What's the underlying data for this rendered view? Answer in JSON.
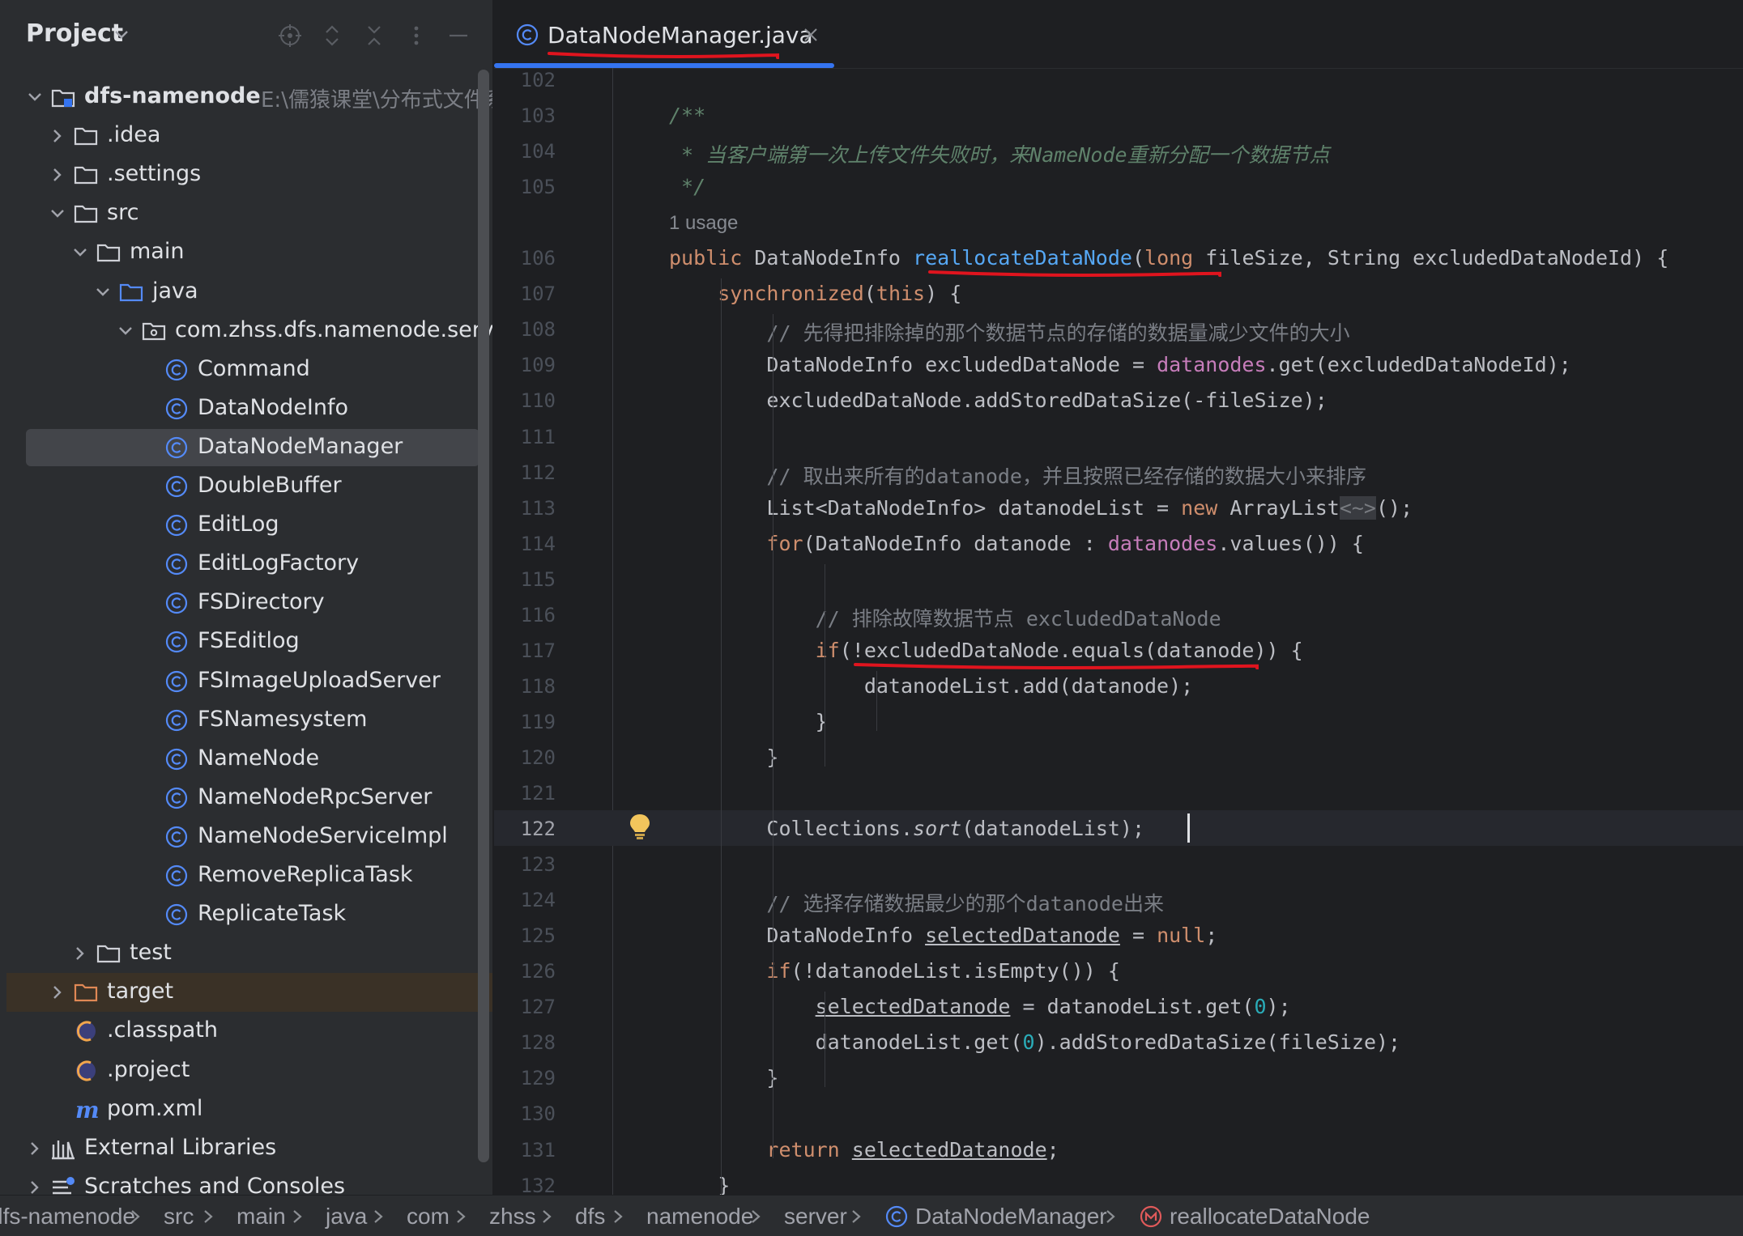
{
  "project_panel": {
    "title": "Project",
    "tree": [
      {
        "label": "dfs-namenode",
        "path": "E:\\儒猿课堂\\分布式文件系",
        "type": "module",
        "expanded": true
      },
      {
        "label": ".idea",
        "type": "folder",
        "expanded": false
      },
      {
        "label": ".settings",
        "type": "folder",
        "expanded": false
      },
      {
        "label": "src",
        "type": "folder",
        "expanded": true
      },
      {
        "label": "main",
        "type": "folder",
        "expanded": true
      },
      {
        "label": "java",
        "type": "source-folder",
        "expanded": true
      },
      {
        "label": "com.zhss.dfs.namenode.server",
        "type": "package",
        "expanded": true
      },
      {
        "label": "Command",
        "type": "class"
      },
      {
        "label": "DataNodeInfo",
        "type": "class"
      },
      {
        "label": "DataNodeManager",
        "type": "class",
        "selected": true
      },
      {
        "label": "DoubleBuffer",
        "type": "class"
      },
      {
        "label": "EditLog",
        "type": "class"
      },
      {
        "label": "EditLogFactory",
        "type": "class"
      },
      {
        "label": "FSDirectory",
        "type": "class"
      },
      {
        "label": "FSEditlog",
        "type": "class"
      },
      {
        "label": "FSImageUploadServer",
        "type": "class"
      },
      {
        "label": "FSNamesystem",
        "type": "class"
      },
      {
        "label": "NameNode",
        "type": "class"
      },
      {
        "label": "NameNodeRpcServer",
        "type": "class"
      },
      {
        "label": "NameNodeServiceImpl",
        "type": "class"
      },
      {
        "label": "RemoveReplicaTask",
        "type": "class"
      },
      {
        "label": "ReplicateTask",
        "type": "class"
      },
      {
        "label": "test",
        "type": "folder",
        "expanded": false
      },
      {
        "label": "target",
        "type": "excluded-folder",
        "expanded": false
      },
      {
        "label": ".classpath",
        "type": "eclipse-file"
      },
      {
        "label": ".project",
        "type": "eclipse-file"
      },
      {
        "label": "pom.xml",
        "type": "maven-file"
      },
      {
        "label": "External Libraries",
        "type": "libraries",
        "expanded": false
      },
      {
        "label": "Scratches and Consoles",
        "type": "scratches",
        "expanded": false
      }
    ]
  },
  "editor": {
    "tab": {
      "label": "DataNodeManager.java",
      "icon": "class-icon"
    },
    "usage_hint": "1 usage",
    "current_line": "122",
    "lines": [
      {
        "n": "102",
        "text": ""
      },
      {
        "n": "103",
        "text": "    /**"
      },
      {
        "n": "104",
        "text": "     * 当客户端第一次上传文件失败时，来NameNode重新分配一个数据节点"
      },
      {
        "n": "105",
        "text": "     */"
      },
      {
        "n": "106",
        "text": "    public DataNodeInfo reallocateDataNode(long fileSize, String excludedDataNodeId) {"
      },
      {
        "n": "107",
        "text": "        synchronized(this) {"
      },
      {
        "n": "108",
        "text": "            // 先得把排除掉的那个数据节点的存储的数据量减少文件的大小"
      },
      {
        "n": "109",
        "text": "            DataNodeInfo excludedDataNode = datanodes.get(excludedDataNodeId);"
      },
      {
        "n": "110",
        "text": "            excludedDataNode.addStoredDataSize(-fileSize);"
      },
      {
        "n": "111",
        "text": ""
      },
      {
        "n": "112",
        "text": "            // 取出来所有的datanode，并且按照已经存储的数据大小来排序"
      },
      {
        "n": "113",
        "text": "            List<DataNodeInfo> datanodeList = new ArrayList<~>();"
      },
      {
        "n": "114",
        "text": "            for(DataNodeInfo datanode : datanodes.values()) {"
      },
      {
        "n": "115",
        "text": ""
      },
      {
        "n": "116",
        "text": "                // 排除故障数据节点 excludedDataNode"
      },
      {
        "n": "117",
        "text": "                if(!excludedDataNode.equals(datanode)) {"
      },
      {
        "n": "118",
        "text": "                    datanodeList.add(datanode);"
      },
      {
        "n": "119",
        "text": "                }"
      },
      {
        "n": "120",
        "text": "            }"
      },
      {
        "n": "121",
        "text": ""
      },
      {
        "n": "122",
        "text": "            Collections.sort(datanodeList); "
      },
      {
        "n": "123",
        "text": ""
      },
      {
        "n": "124",
        "text": "            // 选择存储数据最少的那个datanode出来"
      },
      {
        "n": "125",
        "text": "            DataNodeInfo selectedDatanode = null;"
      },
      {
        "n": "126",
        "text": "            if(!datanodeList.isEmpty()) {"
      },
      {
        "n": "127",
        "text": "                selectedDatanode = datanodeList.get(0);"
      },
      {
        "n": "128",
        "text": "                datanodeList.get(0).addStoredDataSize(fileSize);"
      },
      {
        "n": "129",
        "text": "            }"
      },
      {
        "n": "130",
        "text": ""
      },
      {
        "n": "131",
        "text": "            return selectedDatanode;"
      },
      {
        "n": "132",
        "text": "        }"
      }
    ]
  },
  "breadcrumb": {
    "items": [
      "dfs-namenode",
      "src",
      "main",
      "java",
      "com",
      "zhss",
      "dfs",
      "namenode",
      "server",
      "DataNodeManager",
      "reallocateDataNode"
    ],
    "item_icons": {
      "DataNodeManager": "class-icon",
      "reallocateDataNode": "method-icon"
    }
  },
  "colors": {
    "background": "#1e1f22",
    "panel": "#2b2d30",
    "accent": "#3574f0",
    "keyword": "#cf8e6d",
    "function": "#56a8f5",
    "field": "#c77dbb",
    "number": "#2aacb8",
    "doc_comment": "#5f826b",
    "annotation_red": "#e0141e"
  }
}
